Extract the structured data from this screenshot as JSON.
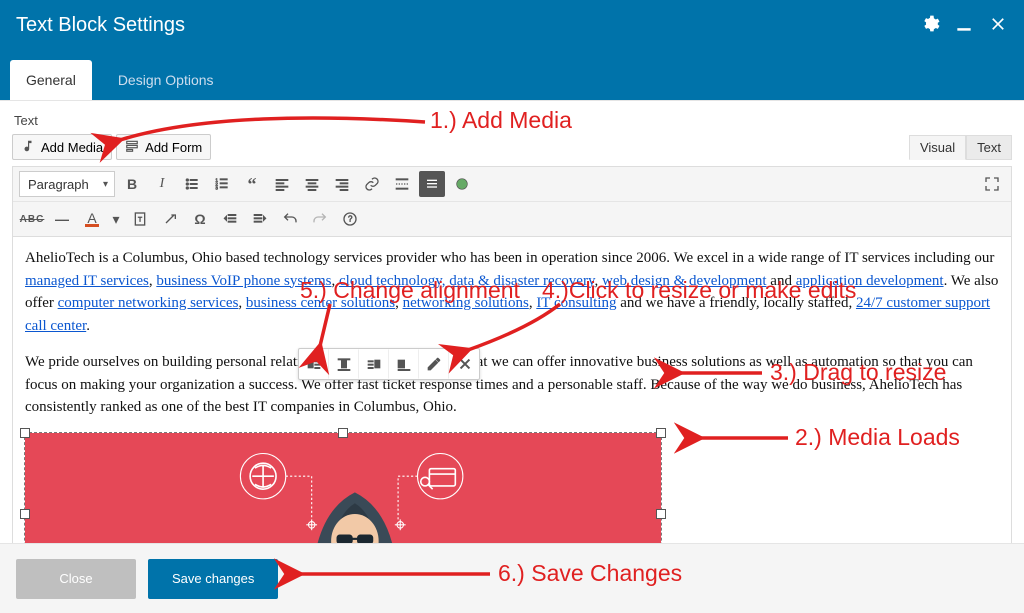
{
  "header": {
    "title": "Text Block Settings"
  },
  "tabs": {
    "general": "General",
    "design": "Design Options"
  },
  "field_label": "Text",
  "media_buttons": {
    "add_media": "Add Media",
    "add_form": "Add Form"
  },
  "editor_tabs": {
    "visual": "Visual",
    "text": "Text"
  },
  "format_select": "Paragraph",
  "links": {
    "managed_it": "managed IT services",
    "voip": "business VoIP phone systems",
    "cloud": "cloud technology, data & disaster recovery",
    "webdev": "web design & development",
    "appdev": "application development",
    "netserv": "computer networking services",
    "bizcenter": "business center solutions",
    "netsol": "networking solutions",
    "itcons": "IT consulting",
    "support": "24/7 customer support call center"
  },
  "paragraphs": {
    "p1_pre": "AhelioTech is a Columbus, Ohio based technology services provider who has been in operation since 2006.  We excel in a wide range of IT services including our ",
    "p1_mid1": ", ",
    "p1_mid2": ", ",
    "p1_mid3": ", ",
    "p1_and": " and ",
    "p1_post1": ". We also offer ",
    "p1_c1": ", ",
    "p1_c2": ", ",
    "p1_c3": ", ",
    "p1_post2": " and we have a friendly, locally staffed, ",
    "p1_end": ".",
    "p2": "We pride ourselves on building personal relationships with our clients so that we can offer innovative business solutions as well as automation so that you can focus on making your organization a success. We offer fast ticket response times and a personable staff. Because of the way we do business, AhelioTech has consistently ranked as one of the best IT companies in Columbus, Ohio."
  },
  "footer": {
    "close": "Close",
    "save": "Save changes"
  },
  "annotations": {
    "a1": "1.) Add Media",
    "a2": "2.) Media Loads",
    "a3": "3.) Drag to resize",
    "a4": "4.)Click to resize or make edits",
    "a5": "5.) Change alignment",
    "a6": "6.) Save Changes"
  },
  "colors": {
    "brand": "#0073aa",
    "annot": "#e02020",
    "image_bg": "#e54857",
    "link": "#0b57d0"
  }
}
